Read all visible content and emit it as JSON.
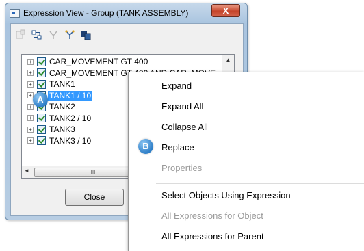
{
  "window": {
    "title": "Expression View - Group (TANK ASSEMBLY)",
    "close_glyph": "X"
  },
  "toolbar": {
    "icons": [
      "properties-icon",
      "expand-tree-icon",
      "filter-icon",
      "hierarchy-icon",
      "copy-icon"
    ]
  },
  "tree": {
    "rows": [
      {
        "label": "CAR_MOVEMENT GT 400",
        "checked": true,
        "selected": false
      },
      {
        "label": "CAR_MOVEMENT GT 400 AND CAR_MOVE",
        "checked": true,
        "selected": false
      },
      {
        "label": "TANK1",
        "checked": true,
        "selected": false
      },
      {
        "label": "TANK1 / 10",
        "checked": true,
        "selected": true
      },
      {
        "label": "TANK2",
        "checked": true,
        "selected": false
      },
      {
        "label": "TANK2 / 10",
        "checked": true,
        "selected": false
      },
      {
        "label": "TANK3",
        "checked": true,
        "selected": false
      },
      {
        "label": "TANK3 / 10",
        "checked": true,
        "selected": false
      }
    ],
    "expander_glyph": "+",
    "scroll_up_glyph": "▲",
    "scroll_left_glyph": "◄",
    "scroll_thumb_grip": "III"
  },
  "buttons": {
    "close_label": "Close"
  },
  "callouts": {
    "a": "A",
    "b": "B"
  },
  "context_menu": {
    "items": [
      {
        "label": "Expand",
        "enabled": true
      },
      {
        "label": "Expand All",
        "enabled": true
      },
      {
        "label": "Collapse All",
        "enabled": true
      },
      {
        "label": "Replace",
        "enabled": true
      },
      {
        "label": "Properties",
        "enabled": false
      },
      {
        "label": "Select Objects Using Expression",
        "enabled": true
      },
      {
        "label": "All Expressions for Object",
        "enabled": false
      },
      {
        "label": "All Expressions for Parent",
        "enabled": true
      }
    ]
  },
  "colors": {
    "selection": "#3399ff",
    "callout": "#2f7fc8",
    "close_button": "#c5442a",
    "disabled_text": "#9a9a9a"
  }
}
